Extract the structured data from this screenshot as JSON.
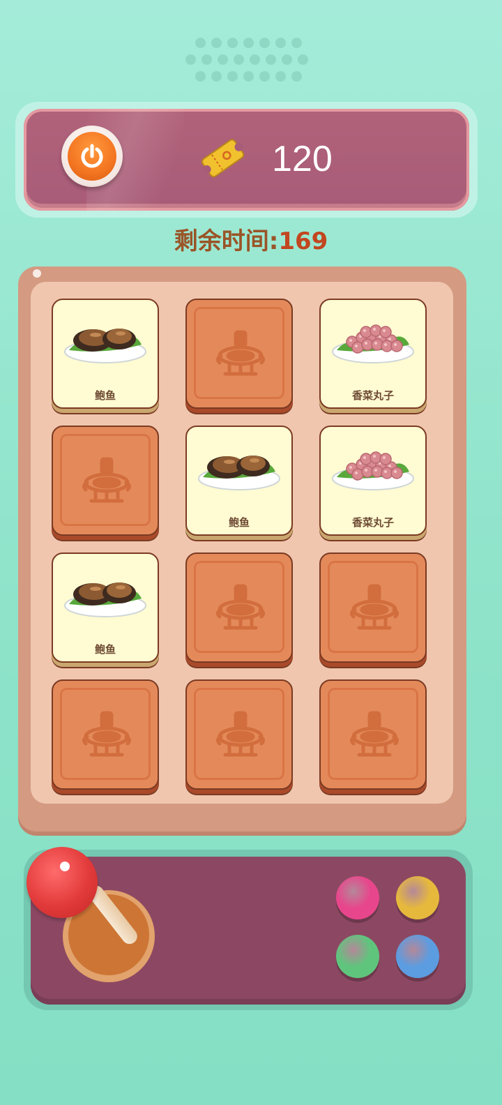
{
  "header": {
    "power_icon": "power-icon",
    "ticket_icon": "ticket-icon",
    "score": "120"
  },
  "timer": {
    "label": "剩余时间:",
    "value": "169"
  },
  "board": {
    "rows": 4,
    "cols": 3,
    "back_icon": "hotpot-icon",
    "cards": [
      {
        "state": "revealed",
        "food": "abalone",
        "label": "鲍鱼"
      },
      {
        "state": "hidden"
      },
      {
        "state": "revealed",
        "food": "meatballs",
        "label": "香菜丸子"
      },
      {
        "state": "hidden"
      },
      {
        "state": "revealed",
        "food": "abalone",
        "label": "鲍鱼"
      },
      {
        "state": "revealed",
        "food": "meatballs",
        "label": "香菜丸子"
      },
      {
        "state": "revealed",
        "food": "abalone",
        "label": "鲍鱼"
      },
      {
        "state": "hidden"
      },
      {
        "state": "hidden"
      },
      {
        "state": "hidden"
      },
      {
        "state": "hidden"
      },
      {
        "state": "hidden"
      }
    ]
  },
  "controller": {
    "joystick_color": "#e23a3a",
    "buttons": [
      {
        "name": "pink",
        "color": "#e8468c"
      },
      {
        "name": "yellow",
        "color": "#e6b93d"
      },
      {
        "name": "green",
        "color": "#5fc57d"
      },
      {
        "name": "blue",
        "color": "#5c9ce0"
      }
    ]
  }
}
